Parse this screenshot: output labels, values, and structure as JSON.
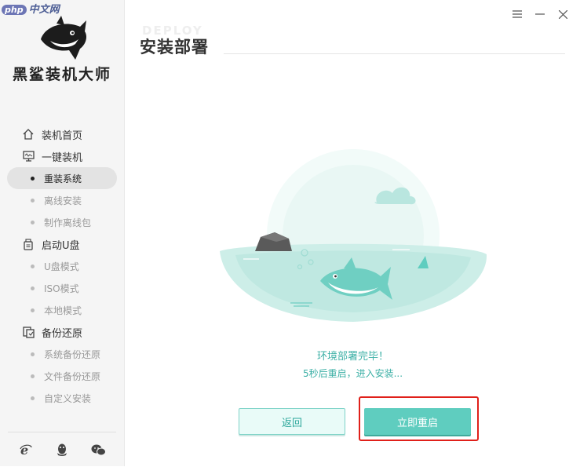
{
  "watermark": {
    "logo": "php",
    "text": "中文网"
  },
  "app": {
    "title": "黑鲨装机大师"
  },
  "window_controls": {
    "menu_icon": "menu-icon",
    "minimize_icon": "minimize-icon",
    "close_icon": "close-icon"
  },
  "sidebar": {
    "groups": [
      {
        "label": "装机首页",
        "icon": "home-icon"
      },
      {
        "label": "一键装机",
        "icon": "monitor-icon"
      },
      {
        "label": "启动U盘",
        "icon": "usb-icon"
      },
      {
        "label": "备份还原",
        "icon": "backup-icon"
      }
    ],
    "subitems": {
      "reinstall": "重装系统",
      "offline_install": "离线安装",
      "make_offline_pkg": "制作离线包",
      "usb_mode": "U盘模式",
      "iso_mode": "ISO模式",
      "local_mode": "本地模式",
      "system_backup": "系统备份还原",
      "file_backup": "文件备份还原",
      "custom_install": "自定义安装"
    },
    "active_item": "重装系统",
    "bottom_icons": [
      "ie-icon",
      "qq-icon",
      "wechat-icon"
    ]
  },
  "main": {
    "title": "安装部署",
    "title_shadow": "DEPLOY",
    "status_line1": "环境部署完毕！",
    "status_line2": "5秒后重启，进入安装...",
    "back_button": "返回",
    "restart_button": "立即重启"
  },
  "colors": {
    "accent": "#5fcdbf",
    "accent_text": "#3db0a6",
    "highlight": "#e0201a",
    "sidebar_bg": "#f5f5f5"
  }
}
